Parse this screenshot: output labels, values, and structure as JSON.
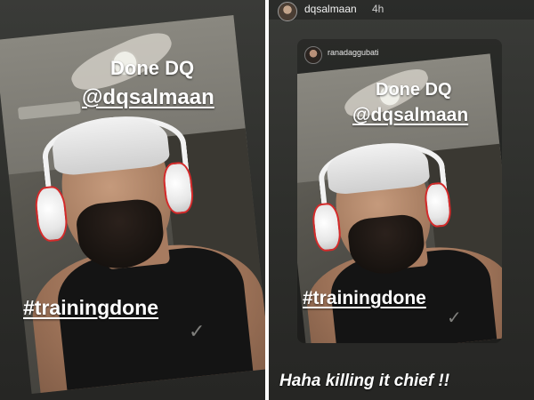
{
  "left_story": {
    "text_line1": "Done DQ",
    "text_line2": "@dqsalmaan",
    "hashtag": "#trainingdone",
    "check_icon": "check-mark-icon"
  },
  "right_story": {
    "username": "dqsalmaan",
    "time": "4h",
    "repost": {
      "username": "ranadaggubati",
      "text_line1": "Done DQ",
      "text_line2": "@dqsalmaan",
      "hashtag": "#trainingdone",
      "check_icon": "check-mark-icon"
    },
    "caption": "Haha killing it chief !!"
  },
  "colors": {
    "panel_bg": "#2f302d",
    "headphone_accent": "#d42a2a",
    "text": "#ffffff"
  }
}
